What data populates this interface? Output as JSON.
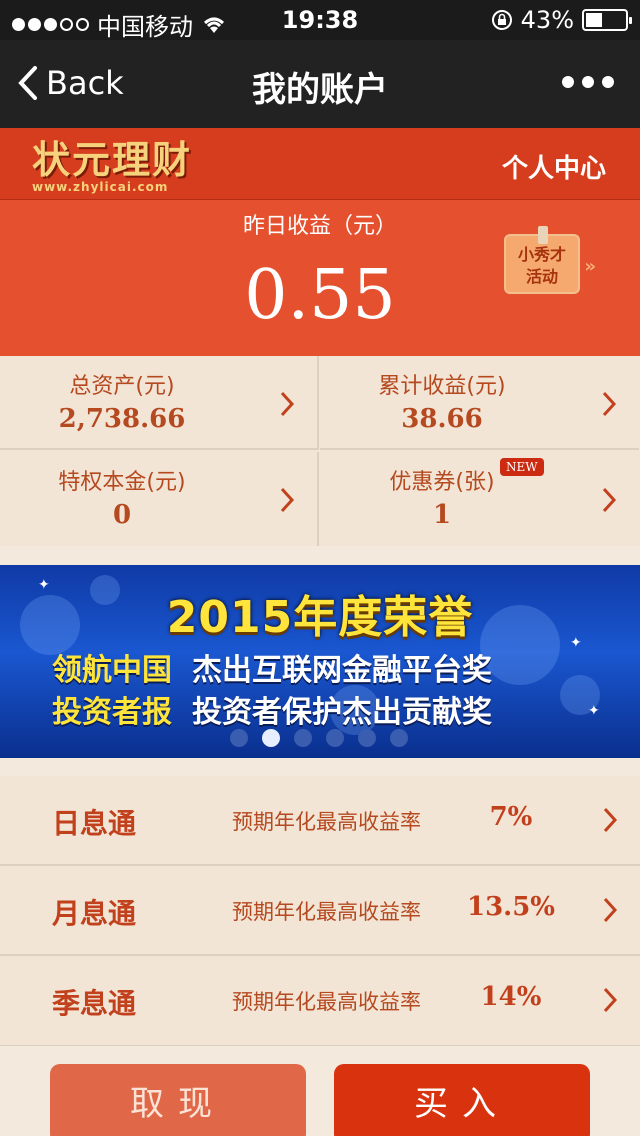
{
  "status_bar": {
    "carrier": "中国移动",
    "time": "19:38",
    "battery": "43%",
    "battery_level": 0.43
  },
  "nav": {
    "back_label": "Back",
    "title": "我的账户"
  },
  "brand": {
    "logo_text": "状元理财",
    "logo_url": "www.zhylicai.com",
    "center_link": "个人中心"
  },
  "earnings": {
    "label": "昨日收益（元）",
    "value": "0.55",
    "badge_line1": "小秀才",
    "badge_line2": "活动"
  },
  "stats": [
    {
      "label": "总资产(元)",
      "value": "2,738.66"
    },
    {
      "label": "累计收益(元)",
      "value": "38.66"
    },
    {
      "label": "特权本金(元)",
      "value": "0"
    },
    {
      "label": "优惠券(张)",
      "value": "1",
      "badge": "NEW"
    }
  ],
  "banner": {
    "headline": "2015年度荣誉",
    "line1_left": "领航中国",
    "line1_right": "杰出互联网金融平台奖",
    "line2_left": "投资者报",
    "line2_right": "投资者保护杰出贡献奖",
    "pages": 6,
    "active_page": 2
  },
  "products": [
    {
      "name": "日息通",
      "desc": "预期年化最高收益率",
      "rate": "7%"
    },
    {
      "name": "月息通",
      "desc": "预期年化最高收益率",
      "rate": "13.5%"
    },
    {
      "name": "季息通",
      "desc": "预期年化最高收益率",
      "rate": "14%"
    }
  ],
  "buttons": {
    "withdraw": "取现",
    "buy": "买入"
  },
  "colors": {
    "brand_red": "#d63d1e",
    "panel_red": "#e5502e",
    "text_brown": "#b5491f",
    "banner_yellow": "#ffe43b"
  }
}
